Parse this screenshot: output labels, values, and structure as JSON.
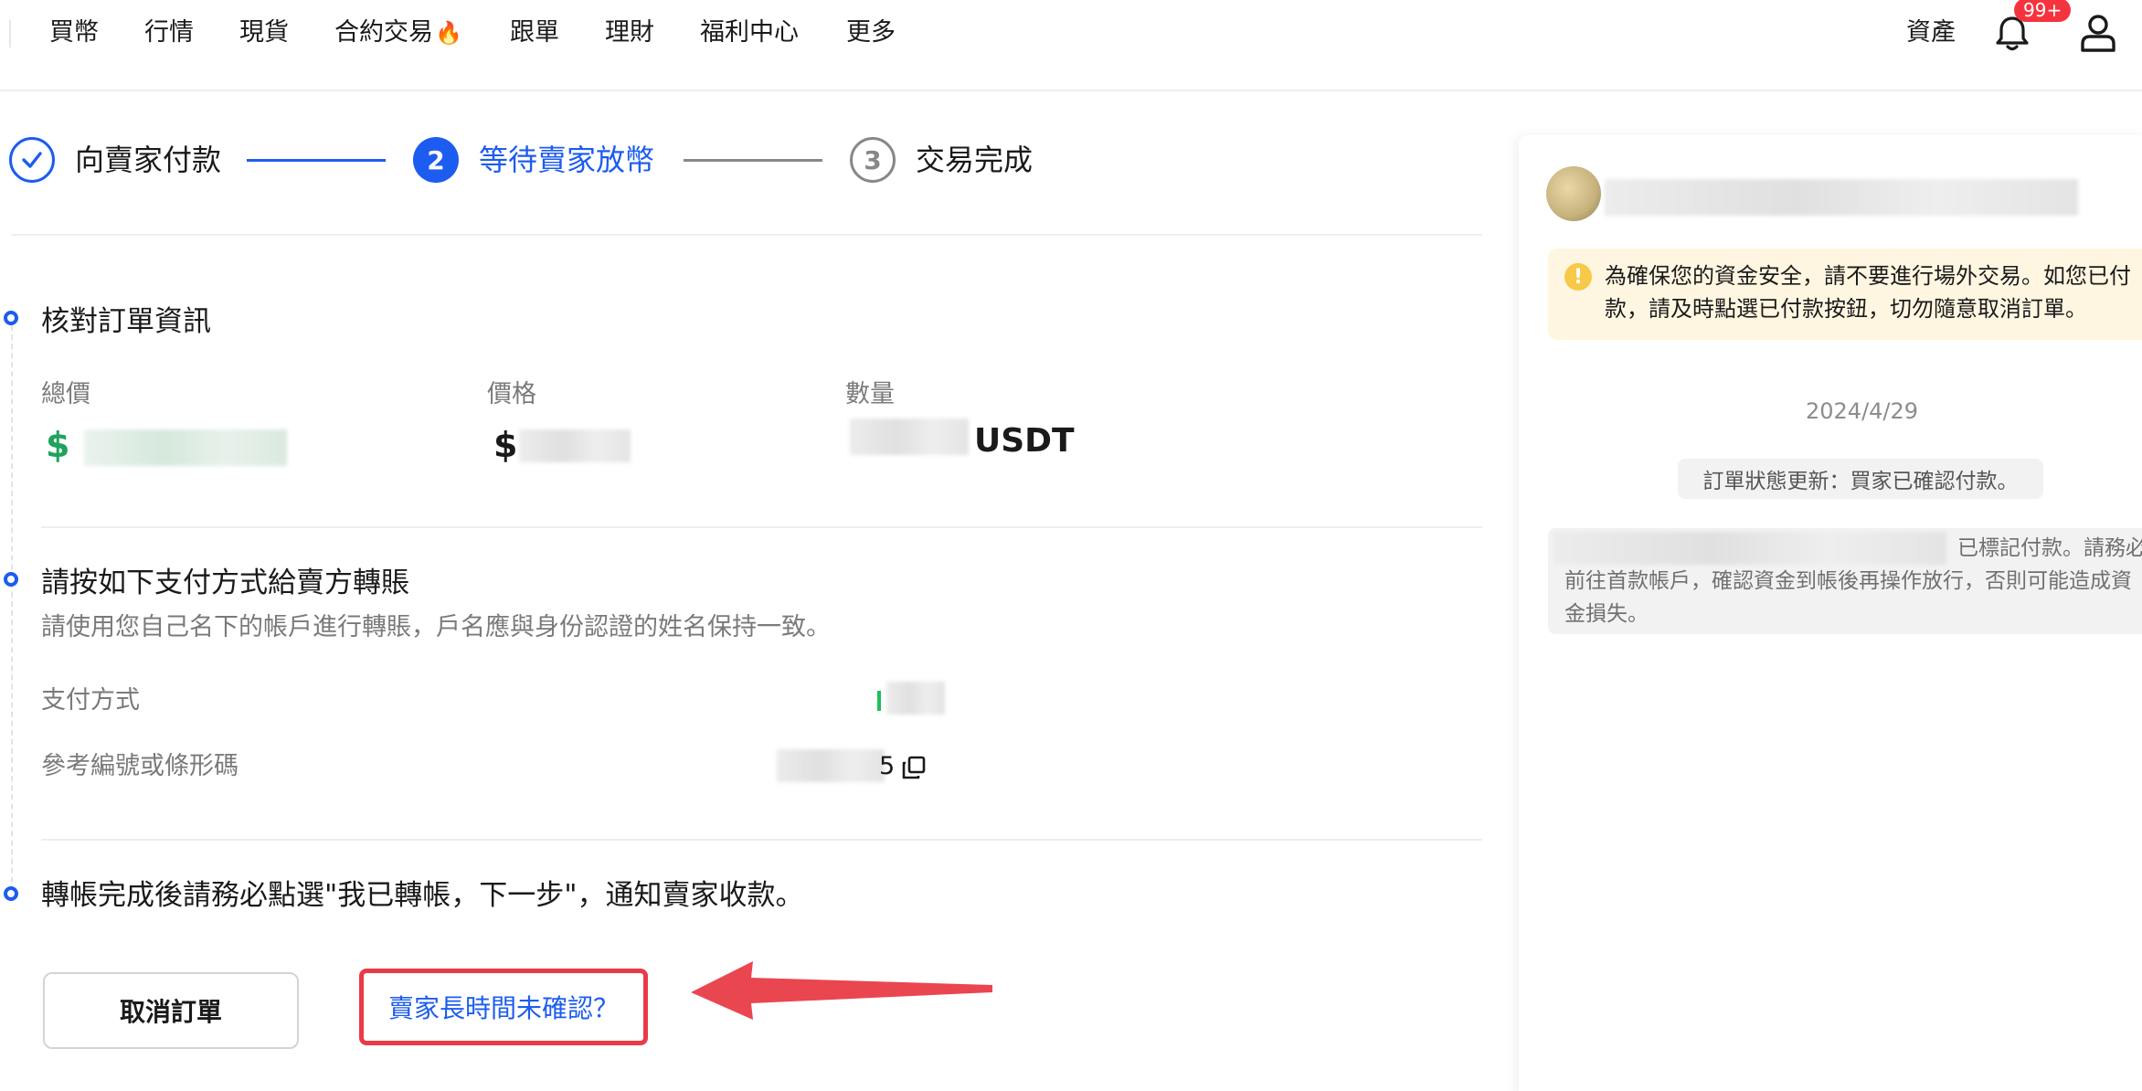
{
  "nav": {
    "items": [
      "買幣",
      "行情",
      "現貨",
      "合約交易",
      "跟單",
      "理財",
      "福利中心",
      "更多"
    ],
    "fire": "🔥",
    "assets": "資產",
    "badge": "99+"
  },
  "steps": {
    "step1_label": "向賣家付款",
    "step2_number": "2",
    "step2_label": "等待賣家放幣",
    "step3_number": "3",
    "step3_label": "交易完成"
  },
  "order": {
    "section_title": "核對訂單資訊",
    "total_label": "總價",
    "price_label": "價格",
    "qty_label": "數量",
    "total_currency": "$",
    "price_currency": "$",
    "qty_unit": "USDT"
  },
  "payment": {
    "section_title": "請按如下支付方式給賣方轉賬",
    "subtitle": "請使用您自己名下的帳戶進行轉賬，戶名應與身份認證的姓名保持一致。",
    "method_label": "支付方式",
    "reference_label": "參考編號或條形碼",
    "reference_tail": "5"
  },
  "confirm": {
    "text": "轉帳完成後請務必點選\"我已轉帳，下一步\"，通知賣家收款。",
    "cancel_button": "取消訂單",
    "seller_link": "賣家長時間未確認？"
  },
  "chat": {
    "warning": "為確保您的資金安全，請不要進行場外交易。如您已付款，請及時點選已付款按鈕，切勿隨意取消訂單。",
    "date": "2024/4/29",
    "status_update": "訂單狀態更新：買家已確認付款。",
    "msg_line1": "已標記付款。請務必",
    "msg_line2": "前往首款帳戶，確認資金到帳後再操作放行，否則可能造成資金損失。"
  },
  "colors": {
    "accent": "#1c5cf0",
    "highlight_red": "#ea3a46",
    "amount_green": "#1fa35c",
    "warning_bg": "#fff6e1"
  }
}
